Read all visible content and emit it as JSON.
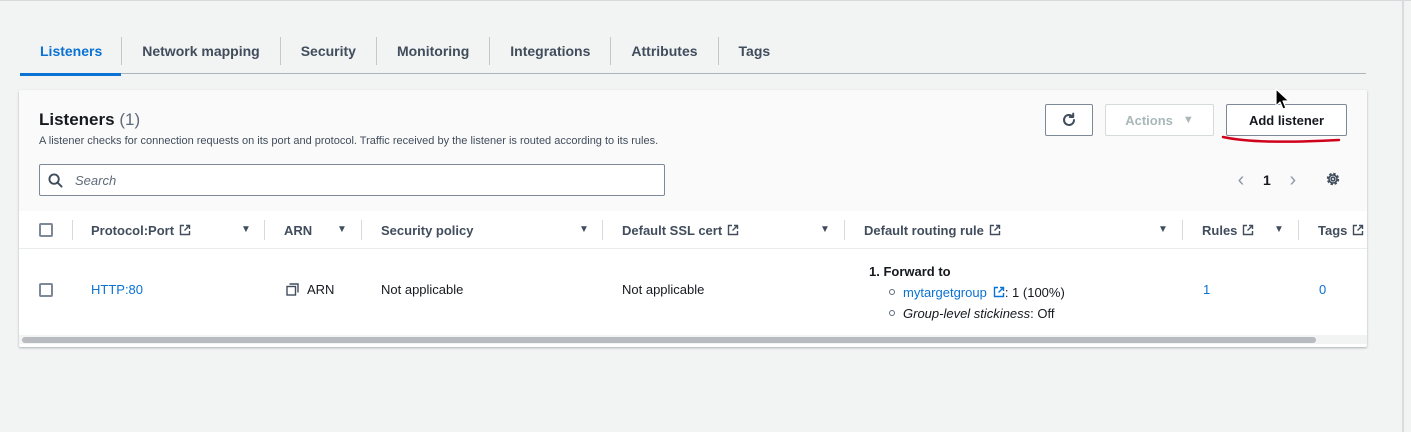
{
  "tabs": [
    {
      "label": "Listeners",
      "active": true
    },
    {
      "label": "Network mapping"
    },
    {
      "label": "Security"
    },
    {
      "label": "Monitoring"
    },
    {
      "label": "Integrations"
    },
    {
      "label": "Attributes"
    },
    {
      "label": "Tags"
    }
  ],
  "panel": {
    "title": "Listeners",
    "count": "(1)",
    "description": "A listener checks for connection requests on its port and protocol. Traffic received by the listener is routed according to its rules.",
    "actions_label": "Actions",
    "add_listener_label": "Add listener",
    "search_placeholder": "Search",
    "page_number": "1"
  },
  "table": {
    "columns": [
      {
        "label": "Protocol:Port",
        "external": true
      },
      {
        "label": "ARN",
        "external": false
      },
      {
        "label": "Security policy",
        "external": false
      },
      {
        "label": "Default SSL cert",
        "external": true
      },
      {
        "label": "Default routing rule",
        "external": true
      },
      {
        "label": "Rules",
        "external": true
      },
      {
        "label": "Tags",
        "external": true
      }
    ],
    "rows": [
      {
        "protocol_port": "HTTP:80",
        "arn": "ARN",
        "security_policy": "Not applicable",
        "ssl_cert": "Not applicable",
        "routing": {
          "heading": "1. Forward to",
          "target_group": "mytargetgroup",
          "weight": ": 1 (100%)",
          "stickiness_label": "Group-level stickiness",
          "stickiness_value": ": Off"
        },
        "rules": "1",
        "tags": "0"
      }
    ]
  },
  "colors": {
    "accent": "#0972d3",
    "annotation": "#d0021b"
  }
}
